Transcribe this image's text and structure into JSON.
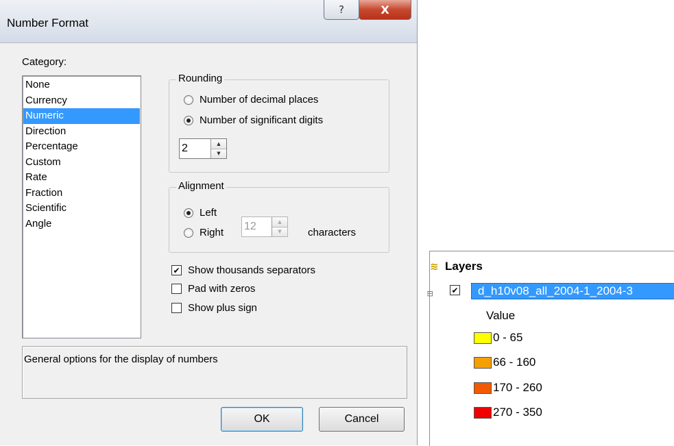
{
  "dialog": {
    "title": "Number Format",
    "help_glyph": "?",
    "close_glyph": "X",
    "category_label": "Category:",
    "categories": [
      "None",
      "Currency",
      "Numeric",
      "Direction",
      "Percentage",
      "Custom",
      "Rate",
      "Fraction",
      "Scientific",
      "Angle"
    ],
    "selected_category": "Numeric",
    "rounding": {
      "legend": "Rounding",
      "decimal_places_label": "Number of decimal places",
      "significant_digits_label": "Number of significant digits",
      "selected": "significant_digits",
      "value": "2"
    },
    "alignment": {
      "legend": "Alignment",
      "left_label": "Left",
      "right_label": "Right",
      "selected": "left",
      "characters_value": "12",
      "characters_label": "characters"
    },
    "options": {
      "thousands_label": "Show thousands separators",
      "thousands_checked": true,
      "pad_label": "Pad with zeros",
      "pad_checked": false,
      "plus_label": "Show plus sign",
      "plus_checked": false
    },
    "description": "General options for the display of numbers",
    "ok_label": "OK",
    "cancel_label": "Cancel"
  },
  "layers": {
    "title": "Layers",
    "tree_toggle": "⊟",
    "layer_name": "d_h10v08_all_2004-1_2004-3",
    "layer_checked": true,
    "value_heading": "Value",
    "legend": [
      {
        "label": "0 - 65",
        "color": "#ffff00"
      },
      {
        "label": "66 - 160",
        "color": "#f5a000"
      },
      {
        "label": "170 - 260",
        "color": "#f25a00"
      },
      {
        "label": "270 - 350",
        "color": "#f00000"
      }
    ]
  }
}
